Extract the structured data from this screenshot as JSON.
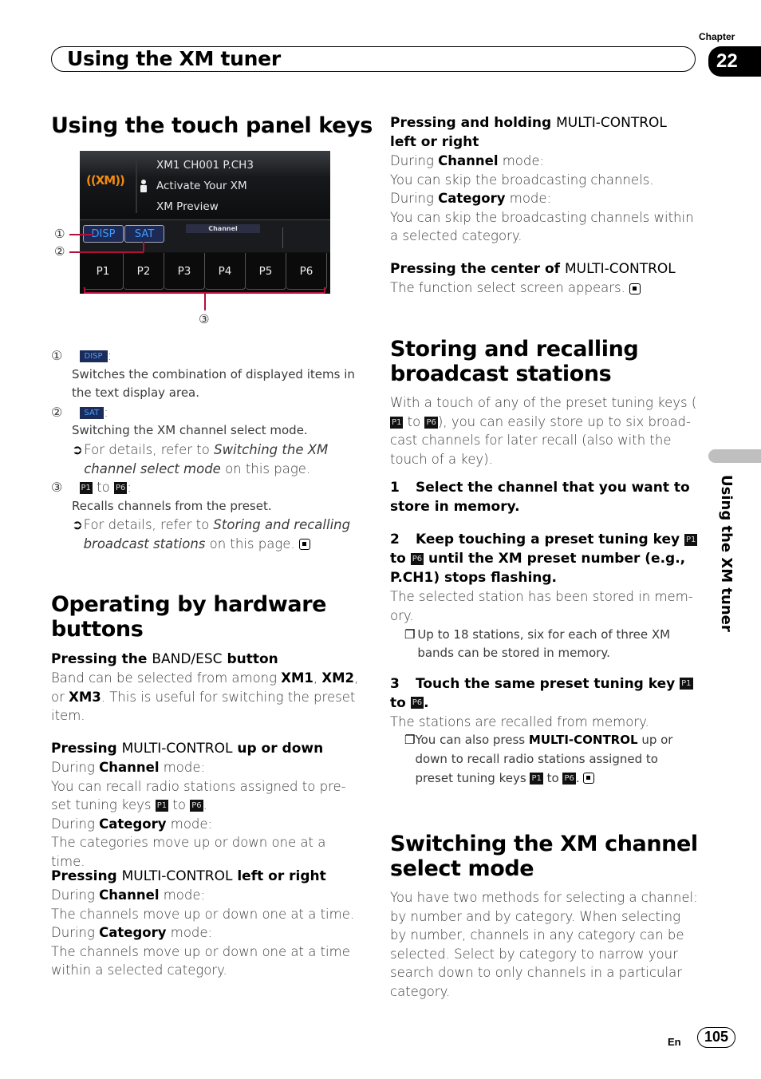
{
  "header": {
    "chapter_label": "Chapter",
    "chapter_number": "22",
    "title": "Using the XM tuner"
  },
  "side_tab": {
    "label": "Using the XM tuner"
  },
  "footer": {
    "lang": "En",
    "page": "105"
  },
  "left": {
    "touch_panel": {
      "heading": "Using the touch panel keys",
      "screen": {
        "logo": "((XM))",
        "line1": "XM1 CH001 P.CH3",
        "line2": "Activate Your XM",
        "line3": "XM Preview",
        "disp_btn": "DISP",
        "sat_btn": "SAT",
        "mode_label": "Channel",
        "presets": [
          "P1",
          "P2",
          "P3",
          "P4",
          "P5",
          "P6"
        ],
        "callouts": [
          "①",
          "②",
          "③"
        ]
      },
      "items": [
        {
          "num": "①",
          "key": "DISP",
          "desc": "Switches the combination of displayed items in the text display area."
        },
        {
          "num": "②",
          "key": "SAT",
          "desc": "Switching the XM channel select mode.",
          "ref_prefix": "For details, refer to ",
          "ref_link": "Switching the XM channel select mode",
          "ref_suffix": " on this page."
        },
        {
          "num": "③",
          "key_from": "P1",
          "to": "to",
          "key_to": "P6",
          "desc": "Recalls channels from the preset.",
          "ref_prefix": "For details, refer to ",
          "ref_link": "Storing and recalling broadcast stations",
          "ref_suffix": " on this page."
        }
      ]
    },
    "hardware": {
      "heading": "Operating by hardware buttons",
      "band": {
        "title_a": "Pressing the ",
        "title_b": "BAND/ESC",
        "title_c": " button",
        "t1": "Band can be selected from among ",
        "xm1": "XM1",
        "t2": ", ",
        "xm2": "XM2",
        "t3": ", or ",
        "xm3": "XM3",
        "t4": ". This is useful for switching the preset item."
      },
      "updown": {
        "title_a": "Pressing ",
        "title_b": "MULTI-CONTROL",
        "title_c": " up or down",
        "during": "During ",
        "channel": "Channel",
        "category": "Category",
        "mode": " mode:",
        "channel_desc_a": "You can recall radio stations assigned to pre-set tuning keys ",
        "p1": "P1",
        "to": " to ",
        "p6": "P6",
        "end": ".",
        "category_desc": "The categories move up or down one at a time."
      },
      "leftright": {
        "title_a": "Pressing ",
        "title_b": "MULTI-CONTROL",
        "title_c": " left or right",
        "channel_desc": "The channels move up or down one at a time.",
        "category_desc": "The channels move up or down one at a time within a selected category."
      }
    }
  },
  "right": {
    "hold": {
      "title_a": "Pressing and holding ",
      "title_b": "MULTI-CONTROL",
      "title_c": "left or right",
      "channel_desc": "You can skip the broadcasting channels.",
      "category_desc": "You can skip the broadcasting channels within a selected category."
    },
    "center": {
      "title_a": "Pressing the center of ",
      "title_b": "MULTI-CONTROL",
      "desc": "The function select screen appears."
    },
    "storing": {
      "heading": "Storing and recalling broadcast stations",
      "intro_a": "With a touch of any of the preset tuning keys (",
      "intro_b": "), you can easily store up to six broad-cast channels for later recall (also with the touch of a key).",
      "step1_num": "1",
      "step1": "Select the channel that you want to store in memory.",
      "step2_num": "2",
      "step2_a": "Keep touching a preset tuning key ",
      "step2_b": " until the XM preset number (e.g., P.CH1) stops flashing.",
      "step2_desc": "The selected station has been stored in mem-ory.",
      "step2_note": "Up to 18 stations, six for each of three XM bands can be stored in memory.",
      "step3_num": "3",
      "step3_a": "Touch the same preset tuning key ",
      "step3_desc": "The stations are recalled from memory.",
      "step3_note_a": "You can also press ",
      "step3_note_b": "MULTI-CONTROL",
      "step3_note_c": " up or down to recall radio stations assigned to preset tuning keys ",
      "p1": "P1",
      "p6": "P6",
      "to": "to"
    },
    "switching": {
      "heading": "Switching the XM channel select mode",
      "desc": "You have two methods for selecting a channel: by number and by category. When selecting by number, channels in any category can be selected. Select by category to narrow your search down to only channels in a particular category."
    }
  }
}
